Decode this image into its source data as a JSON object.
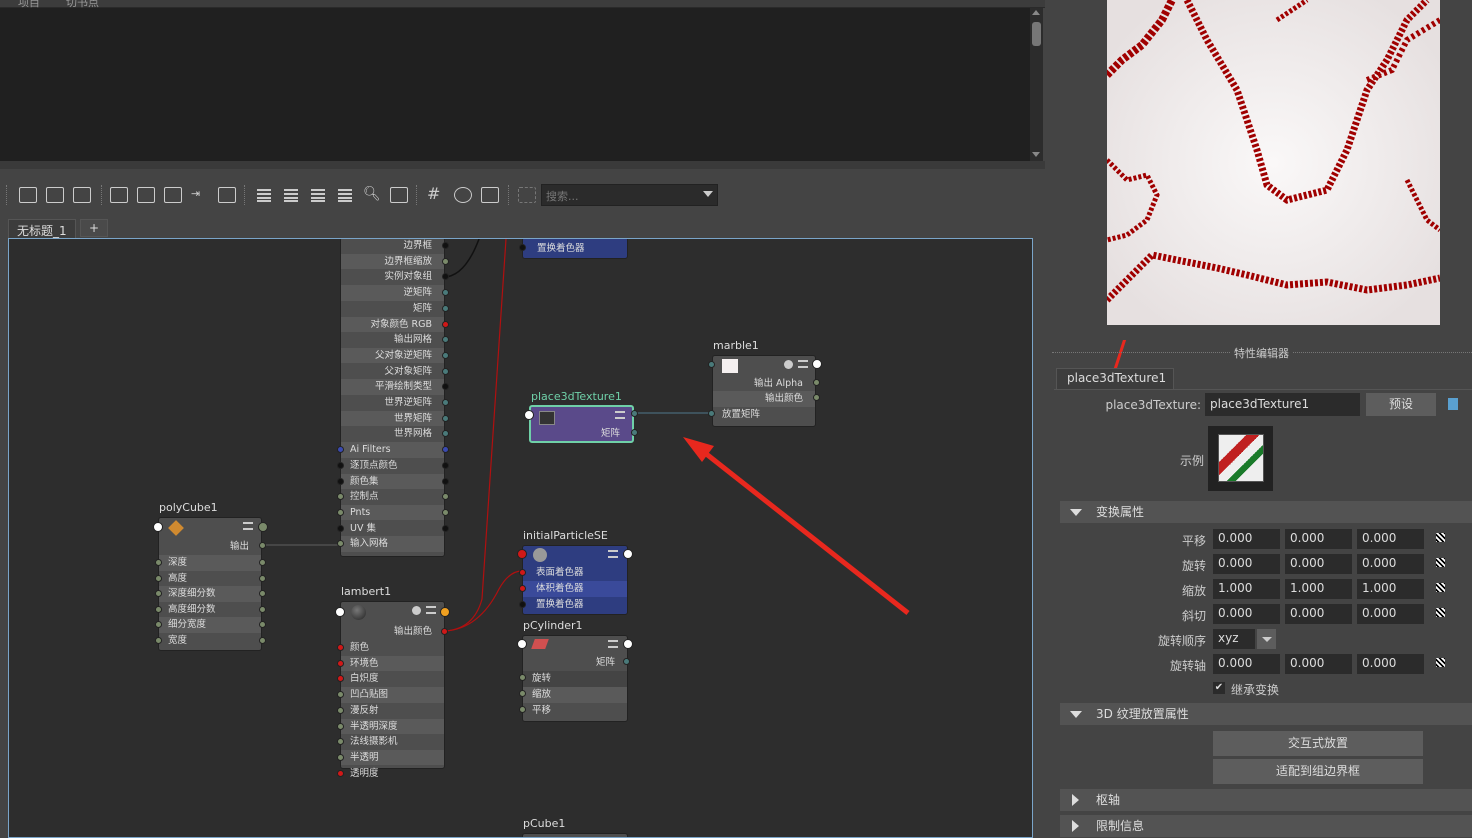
{
  "top_tabs": [
    "项目",
    "切书点"
  ],
  "toolbar": {
    "search_placeholder": "搜索..."
  },
  "tabs": {
    "active": "无标题_1",
    "add": "+"
  },
  "nodes": {
    "mesh": {
      "rows": [
        "边界框",
        "边界框缩放",
        "实例对象组",
        "逆矩阵",
        "矩阵",
        "对象颜色 RGB",
        "输出网格",
        "父对象逆矩阵",
        "父对象矩阵",
        "平滑绘制类型",
        "世界逆矩阵",
        "世界矩阵",
        "世界网格"
      ],
      "lrows": [
        "Ai Filters",
        "逐顶点颜色",
        "颜色集",
        "控制点",
        "Pnts",
        "UV 集",
        "输入网格"
      ]
    },
    "shadingTop": {
      "row": "置换着色器"
    },
    "place3d": {
      "title": "place3dTexture1",
      "row": "矩阵"
    },
    "marble": {
      "title": "marble1",
      "rows": [
        "输出 Alpha",
        "输出颜色",
        "放置矩阵"
      ]
    },
    "polyCube": {
      "title": "polyCube1",
      "out": "输出",
      "rows": [
        "深度",
        "高度",
        "深度细分数",
        "高度细分数",
        "细分宽度",
        "宽度"
      ]
    },
    "lambert": {
      "title": "lambert1",
      "out": "输出颜色",
      "rows": [
        "颜色",
        "环境色",
        "白炽度",
        "凹凸贴图",
        "漫反射",
        "半透明深度",
        "法线摄影机",
        "半透明",
        "透明度"
      ]
    },
    "particleSE": {
      "title": "initialParticleSE",
      "rows": [
        "表面着色器",
        "体积着色器",
        "置换着色器"
      ]
    },
    "pCylinder": {
      "title": "pCylinder1",
      "out": "矩阵",
      "rows": [
        "旋转",
        "缩放",
        "平移"
      ]
    },
    "pCube": {
      "title": "pCube1"
    }
  },
  "attr_editor": {
    "header": "特性编辑器",
    "tab": "place3dTexture1",
    "name_label": "place3dTexture:",
    "name_value": "place3dTexture1",
    "preset_btn": "预设",
    "sample_label": "示例",
    "section1": "变换属性",
    "fields": [
      {
        "label": "平移",
        "v": [
          "0.000",
          "0.000",
          "0.000"
        ]
      },
      {
        "label": "旋转",
        "v": [
          "0.000",
          "0.000",
          "0.000"
        ]
      },
      {
        "label": "缩放",
        "v": [
          "1.000",
          "1.000",
          "1.000"
        ]
      },
      {
        "label": "斜切",
        "v": [
          "0.000",
          "0.000",
          "0.000"
        ]
      }
    ],
    "rot_order_label": "旋转顺序",
    "rot_order": "xyz",
    "rot_axis_label": "旋转轴",
    "rot_axis": [
      "0.000",
      "0.000",
      "0.000"
    ],
    "inherit": "继承变换",
    "section2": "3D 纹理放置属性",
    "btn_interactive": "交互式放置",
    "btn_fit": "适配到组边界框",
    "section3": "枢轴",
    "section4": "限制信息"
  }
}
